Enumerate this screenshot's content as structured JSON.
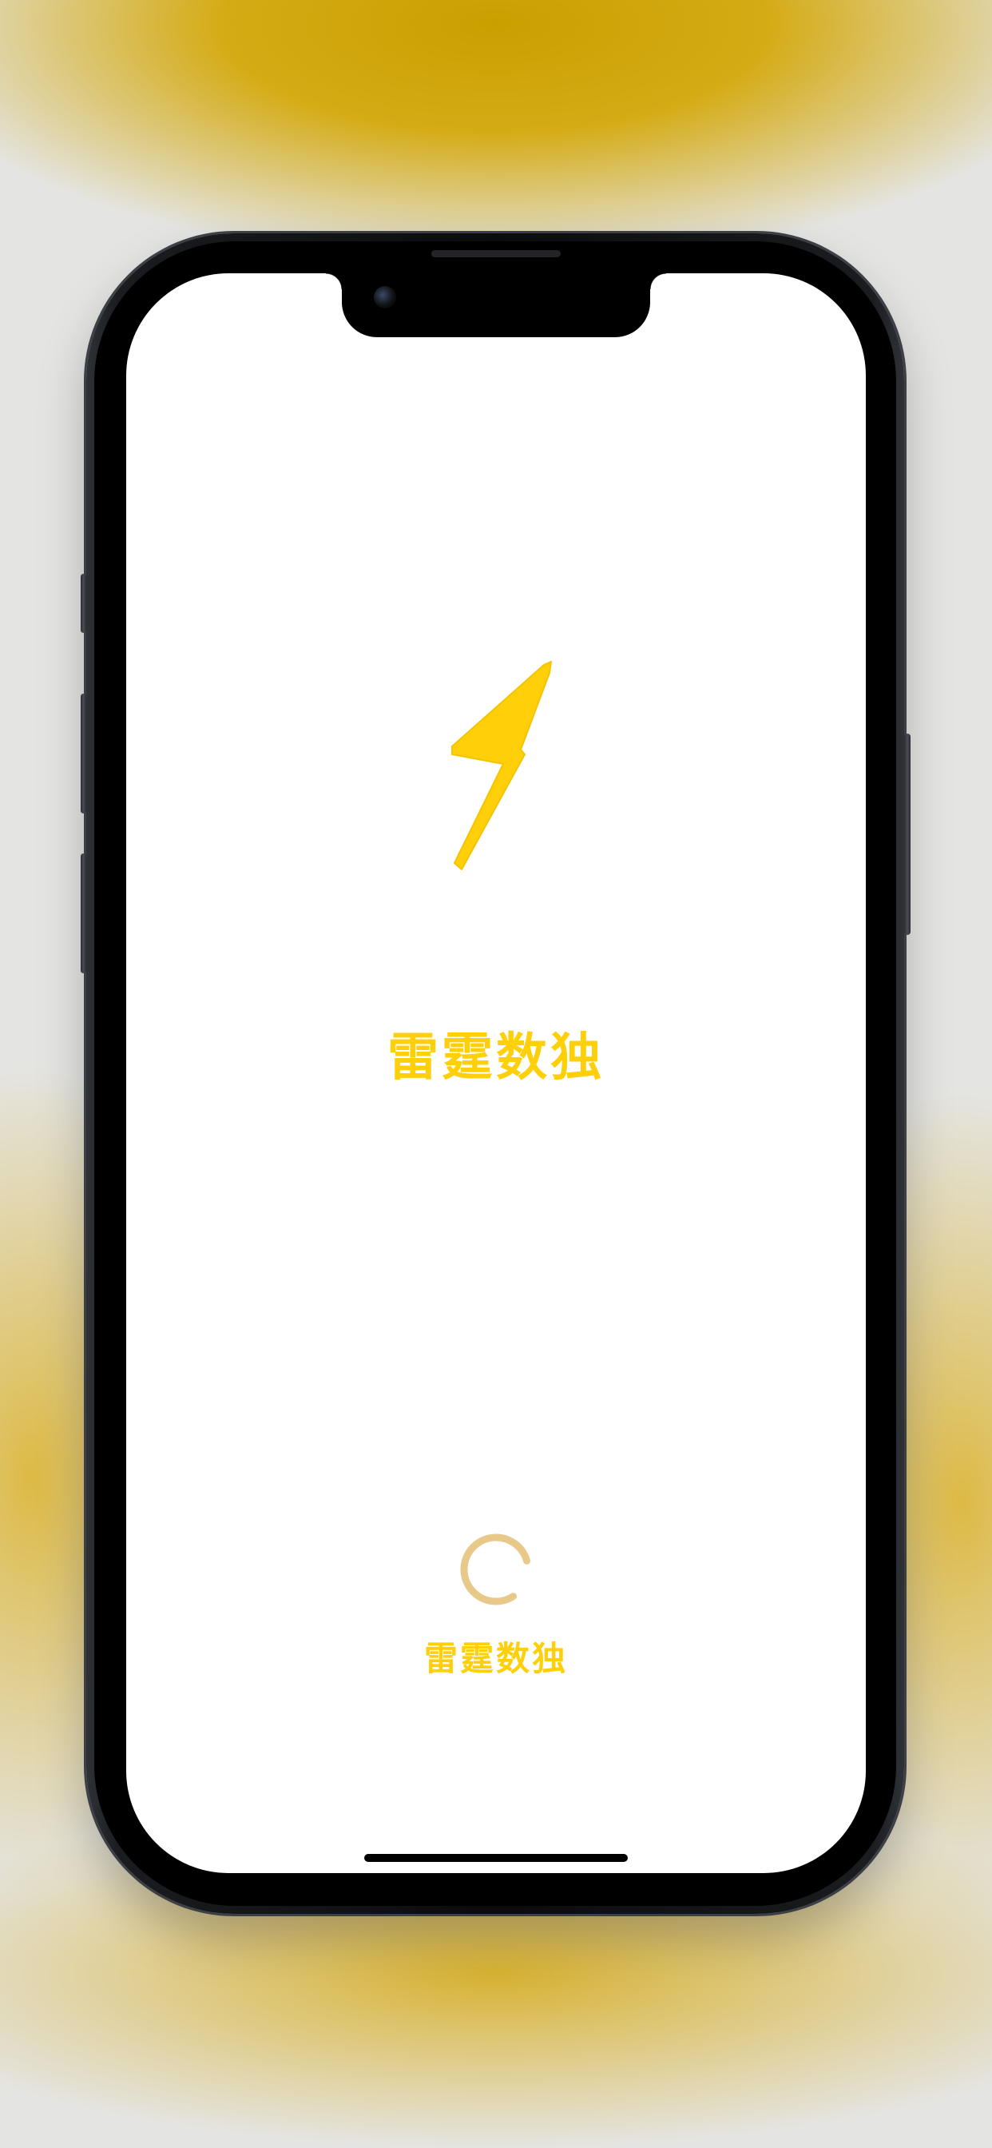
{
  "app": {
    "title": "雷霆数独",
    "loading_label": "雷霆数独"
  },
  "icons": {
    "logo": "lightning-bolt-icon",
    "loading": "loading-spinner-icon",
    "camera": "front-camera"
  },
  "colors": {
    "brand_yellow": "#ffcf0a",
    "spinner": "#e8c98a",
    "screen_background": "#ffffff"
  }
}
